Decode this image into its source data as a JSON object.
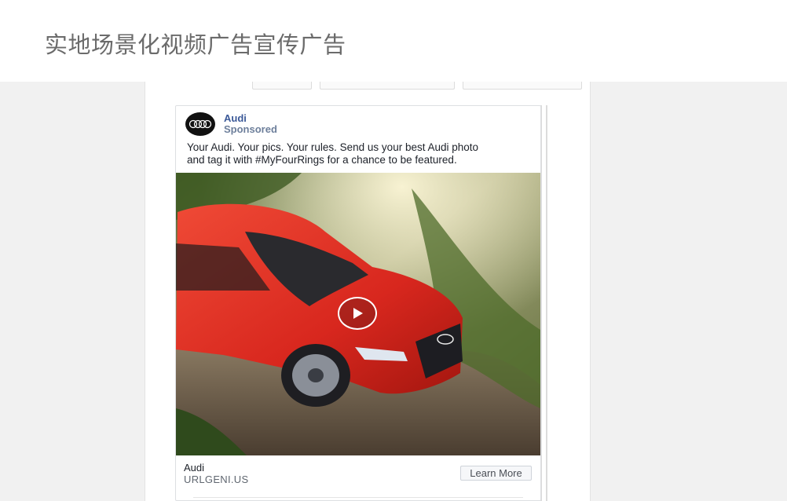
{
  "header": {
    "title": "实地场景化视频广告宣传广告"
  },
  "ad": {
    "page_name": "Audi",
    "sponsored_label": "Sponsored",
    "text_line1": "Your Audi. Your pics. Your rules. Send us your best Audi photo",
    "text_line2": "and tag it with #MyFourRings for a chance to be featured.",
    "media": {
      "type": "video",
      "play_icon": "play-icon"
    },
    "cta": {
      "title": "Audi",
      "domain": "URLGENI.US",
      "button_label": "Learn More"
    }
  },
  "colors": {
    "header_text": "#6b6b6b",
    "page_link": "#3b5998",
    "car_red": "#d8271e",
    "background": "#f1f1f1"
  }
}
